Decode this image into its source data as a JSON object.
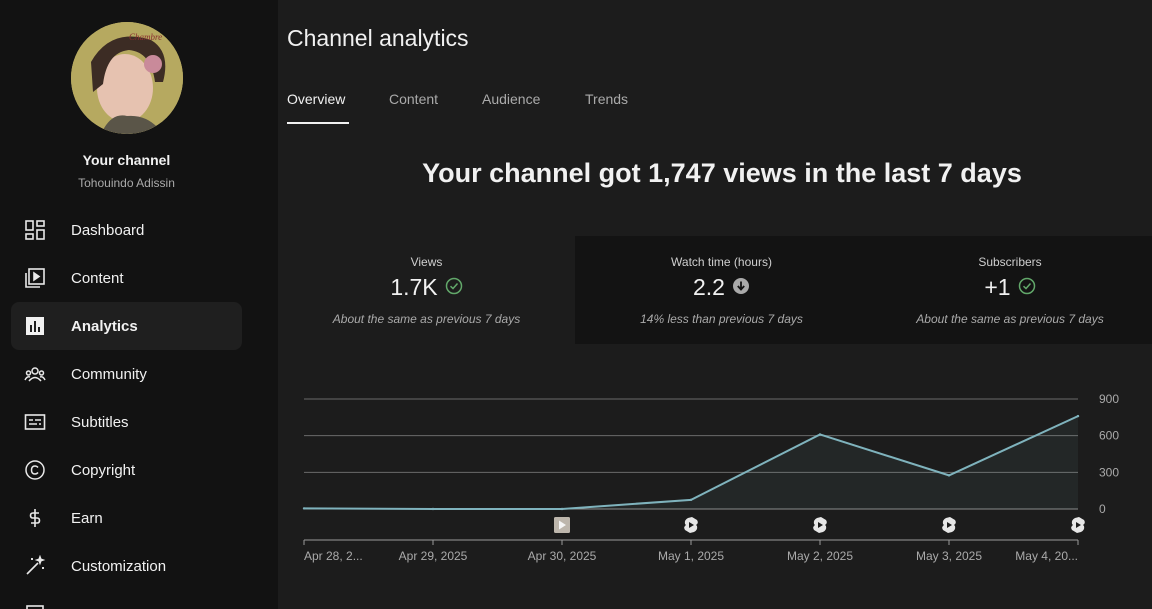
{
  "sidebar": {
    "channel_title": "Your channel",
    "channel_handle": "Tohouindo Adissin",
    "items": [
      {
        "label": "Dashboard",
        "icon": "dashboard-icon"
      },
      {
        "label": "Content",
        "icon": "content-icon"
      },
      {
        "label": "Analytics",
        "icon": "analytics-icon",
        "active": true
      },
      {
        "label": "Community",
        "icon": "community-icon"
      },
      {
        "label": "Subtitles",
        "icon": "subtitles-icon"
      },
      {
        "label": "Copyright",
        "icon": "copyright-icon"
      },
      {
        "label": "Earn",
        "icon": "earn-icon"
      },
      {
        "label": "Customization",
        "icon": "customization-icon"
      }
    ]
  },
  "main": {
    "title": "Channel analytics",
    "tabs": [
      "Overview",
      "Content",
      "Audience",
      "Trends"
    ],
    "active_tab": "Overview",
    "headline": "Your channel got 1,747 views in the last 7 days",
    "cards": [
      {
        "label": "Views",
        "value": "1.7K",
        "note": "About the same as previous 7 days",
        "status": "check-circle-icon"
      },
      {
        "label": "Watch time (hours)",
        "value": "2.2",
        "note": "14% less than previous 7 days",
        "status": "down-arrow-circle-icon"
      },
      {
        "label": "Subscribers",
        "value": "+1",
        "note": "About the same as previous 7 days",
        "status": "check-circle-icon"
      }
    ]
  },
  "colors": {
    "background": "#1c1c1c",
    "sidebar": "#121212",
    "line": "#7fb3bd",
    "check": "#62a86a"
  },
  "chart_data": {
    "type": "area",
    "x": [
      "Apr 28, 2...",
      "Apr 29, 2025",
      "Apr 30, 2025",
      "May 1, 2025",
      "May 2, 2025",
      "May 3, 2025",
      "May 4, 20..."
    ],
    "values": [
      5,
      0,
      0,
      75,
      610,
      275,
      760
    ],
    "ylim": [
      0,
      900
    ],
    "yticks": [
      0,
      300,
      600,
      900
    ],
    "markers": [
      {
        "x_index": 2,
        "icon": "video-upload-icon"
      },
      {
        "x_index": 3,
        "icon": "shorts-icon"
      },
      {
        "x_index": 4,
        "icon": "shorts-icon"
      },
      {
        "x_index": 5,
        "icon": "shorts-icon"
      },
      {
        "x_index": 6,
        "icon": "shorts-icon"
      }
    ],
    "grid": true
  }
}
